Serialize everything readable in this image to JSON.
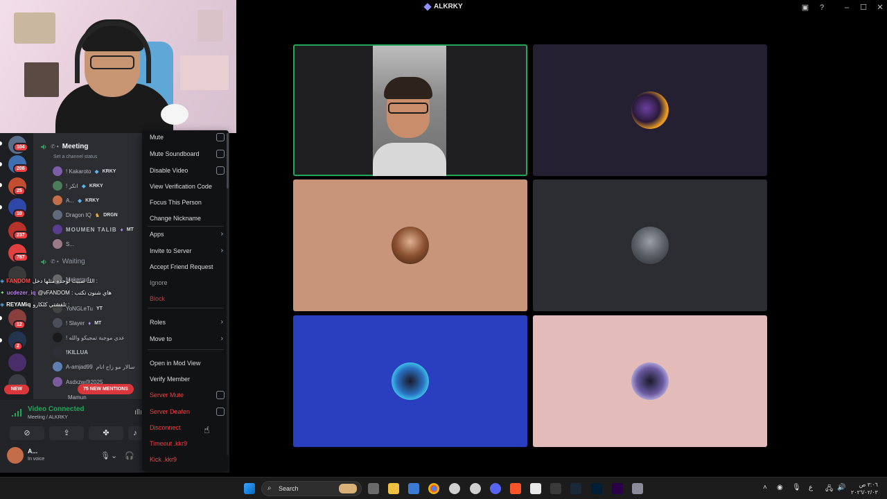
{
  "window": {
    "title": "ALKRKY"
  },
  "sidebar": {
    "guild_badges": [
      "104",
      "208",
      "25",
      "10",
      "237",
      "787",
      "12",
      "2"
    ],
    "voice_channel": {
      "name": "Meeting",
      "status_placeholder": "Set a channel status"
    },
    "members": [
      {
        "name": "! Kakaroto",
        "tag": "KRKY"
      },
      {
        "name": "! اتكر",
        "tag": "KRKY"
      },
      {
        "name": "A...",
        "tag": "KRKY"
      },
      {
        "name": "Dragon IQ",
        "tag": "DRGN"
      },
      {
        "name": "MOUMEN TALIB",
        "tag": "MT"
      },
      {
        "name": "S...",
        "tag": ""
      }
    ],
    "waiting_channel": {
      "name": "Waiting"
    },
    "lower_members": [
      {
        "name": "Makerouf",
        "tag": ""
      },
      {
        "name": "YoNGLeTu",
        "tag": "YT"
      },
      {
        "name": "! Slayer",
        "tag": "MT"
      },
      {
        "name": "! عدي موجبة تمجيكو والله",
        "tag": ""
      },
      {
        "name": "!KILLUA",
        "tag": ""
      },
      {
        "name": "A-amjad99",
        "tag": "سالار مو زاح انام"
      },
      {
        "name": "Asdxzw@2025",
        "tag": ""
      },
      {
        "name": "Mamun",
        "tag": ""
      }
    ],
    "chat": [
      {
        "user": "FANDOM",
        "text": "الك صبيت لوحده مثلها دخل :"
      },
      {
        "user": "ucdezer_iq",
        "text": "@vFANDOM : هاي شنون تكتب"
      },
      {
        "user": "REYAMiq",
        "text": "تلقشتي كلكارو :"
      }
    ],
    "new_mentions": "75 NEW MENTIONS",
    "new_label": "NEW",
    "voice_panel": {
      "status": "Video Connected",
      "location": "Meeting / ALKRKY"
    },
    "user": {
      "name": "A...",
      "status": "In voice"
    }
  },
  "context_menu": {
    "items": [
      {
        "label": "Mute",
        "kind": "check"
      },
      {
        "label": "Mute Soundboard",
        "kind": "check"
      },
      {
        "label": "Disable Video",
        "kind": "check"
      },
      {
        "label": "View Verification Code",
        "kind": "plain"
      },
      {
        "label": "Focus This Person",
        "kind": "plain"
      },
      {
        "label": "Change Nickname",
        "kind": "plain"
      },
      {
        "label": "Apps",
        "kind": "submenu"
      },
      {
        "label": "Invite to Server",
        "kind": "submenu"
      },
      {
        "label": "Accept Friend Request",
        "kind": "plain"
      },
      {
        "label": "Ignore",
        "kind": "muted"
      },
      {
        "label": "Block",
        "kind": "danger-muted"
      },
      {
        "label": "Roles",
        "kind": "submenu"
      },
      {
        "label": "Move to",
        "kind": "submenu"
      },
      {
        "label": "Open in Mod View",
        "kind": "plain"
      },
      {
        "label": "Verify Member",
        "kind": "plain"
      },
      {
        "label": "Server Mute",
        "kind": "danger-check"
      },
      {
        "label": "Server Deafen",
        "kind": "danger-check"
      },
      {
        "label": "Disconnect",
        "kind": "danger"
      },
      {
        "label": "Timeout .kkr9",
        "kind": "danger"
      },
      {
        "label": "Kick .kkr9",
        "kind": "danger"
      }
    ]
  },
  "video_grid": {
    "tiles": [
      {
        "type": "camera",
        "speaking": true,
        "bg": "#1f1f21"
      },
      {
        "type": "avatar",
        "speaking": false,
        "bg": "#242031"
      },
      {
        "type": "avatar",
        "speaking": false,
        "bg": "#c9957a"
      },
      {
        "type": "avatar",
        "speaking": false,
        "bg": "#2b2d33"
      },
      {
        "type": "avatar",
        "speaking": false,
        "bg": "#2a3fbf"
      },
      {
        "type": "avatar",
        "speaking": false,
        "bg": "#e3bcba"
      }
    ]
  },
  "taskbar": {
    "search_placeholder": "Search",
    "clock_time": "٣:٠٦ ص",
    "clock_date": "٢٠٢٦/٠٢/٠٣",
    "lang": "ع"
  },
  "colors": {
    "speaking": "#23a55a",
    "danger": "#f23f43",
    "sidebar_bg": "#2b2d31",
    "menu_bg": "#111214"
  }
}
